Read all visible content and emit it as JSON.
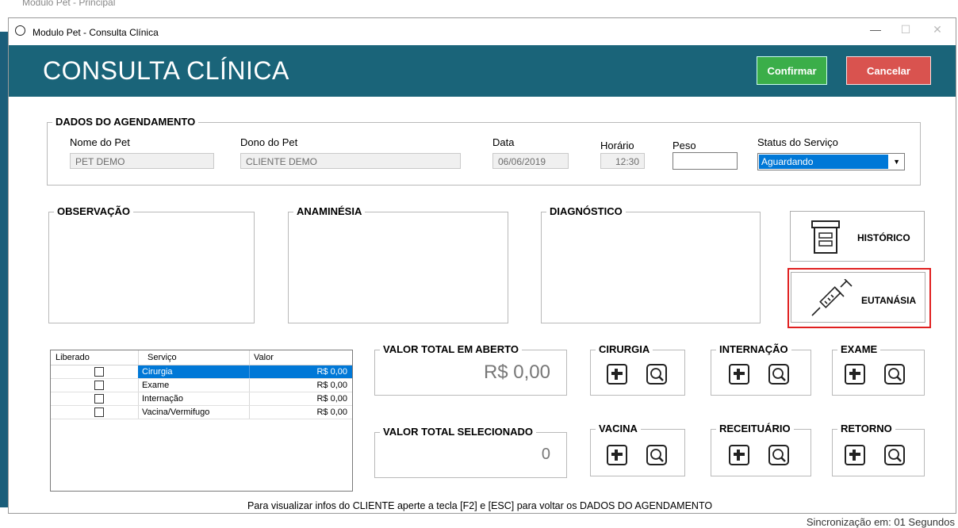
{
  "background_window": {
    "title": "Modulo Pet - Principal",
    "status": "Sincronização em: 01 Segundos"
  },
  "window": {
    "title": "Modulo Pet - Consulta Clínica",
    "minimize": "—",
    "maximize": "☐",
    "close": "✕"
  },
  "header": {
    "title": "CONSULTA CLÍNICA",
    "confirm_label": "Confirmar",
    "cancel_label": "Cancelar"
  },
  "agendamento": {
    "legend": "DADOS DO AGENDAMENTO",
    "pet_label": "Nome do Pet",
    "pet_value": "PET DEMO",
    "owner_label": "Dono do Pet",
    "owner_value": "CLIENTE DEMO",
    "date_label": "Data",
    "date_value": "06/06/2019",
    "time_label": "Horário",
    "time_value": "12:30",
    "weight_label": "Peso",
    "weight_value": "",
    "status_label": "Status do Serviço",
    "status_value": "Aguardando"
  },
  "notes": {
    "observacao": "OBSERVAÇÃO",
    "anaminesia": "ANAMINÉSIA",
    "diagnostico": "DIAGNÓSTICO"
  },
  "side_buttons": {
    "historico": "HISTÓRICO",
    "eutanasia": "EUTANÁSIA"
  },
  "services_table": {
    "headers": [
      "Liberado",
      "Serviço",
      "Valor"
    ],
    "rows": [
      {
        "service": "Cirurgia",
        "value": "R$ 0,00",
        "selected": true
      },
      {
        "service": "Exame",
        "value": "R$ 0,00",
        "selected": false
      },
      {
        "service": "Internação",
        "value": "R$ 0,00",
        "selected": false
      },
      {
        "service": "Vacina/Vermifugo",
        "value": "R$ 0,00",
        "selected": false
      }
    ]
  },
  "totals": {
    "open_label": "VALOR TOTAL EM ABERTO",
    "open_value": "R$ 0,00",
    "selected_label": "VALOR TOTAL SELECIONADO",
    "selected_value": "0"
  },
  "actions": {
    "cirurgia": "CIRURGIA",
    "internacao": "INTERNAÇÃO",
    "exame": "EXAME",
    "vacina": "VACINA",
    "receituario": "RECEITUÁRIO",
    "retorno": "RETORNO"
  },
  "footer_hint": "Para visualizar infos do CLIENTE aperte a tecla [F2] e [ESC] para voltar os DADOS DO AGENDAMENTO",
  "colors": {
    "header": "#1a6479",
    "confirm": "#3bae49",
    "cancel": "#d9534f",
    "selection": "#0078d7",
    "highlight": "#e02020"
  }
}
